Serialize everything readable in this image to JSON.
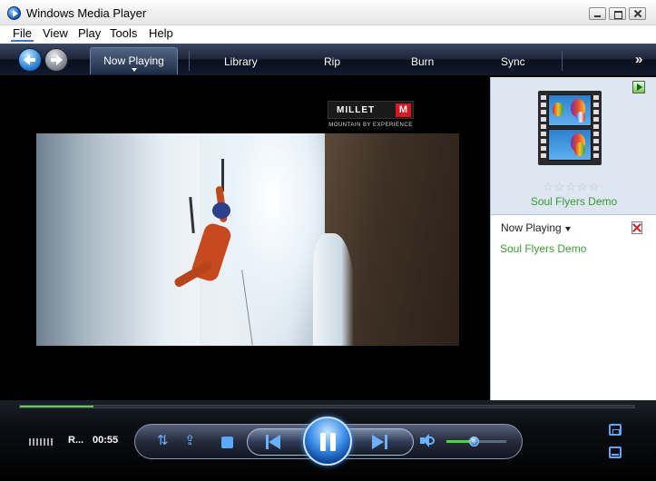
{
  "window": {
    "title": "Windows Media Player"
  },
  "menu": [
    "File",
    "View",
    "Play",
    "Tools",
    "Help"
  ],
  "nav": {
    "active_tab": "Now Playing",
    "tabs": [
      "Library",
      "Rip",
      "Burn",
      "Sync"
    ],
    "more_glyph": "»"
  },
  "video": {
    "logo_text": "MILLET",
    "logo_mark": "M",
    "logo_tagline": "MOUNTAIN BY EXPERIENCE"
  },
  "sidebar": {
    "rating_stars": "☆☆☆☆☆",
    "media_title": "Soul Flyers Demo",
    "playlist_header": "Now Playing",
    "playlist_items": [
      "Soul Flyers Demo"
    ]
  },
  "status": {
    "title_truncated": "R...",
    "time": "00:55",
    "seek_progress": 0.12,
    "volume": 0.45
  },
  "controls": {
    "shuffle_glyph": "⇅",
    "repeat_glyph": "⇪"
  },
  "colors": {
    "accent_green": "#3a9a31",
    "control_blue": "#6ab2ff"
  }
}
